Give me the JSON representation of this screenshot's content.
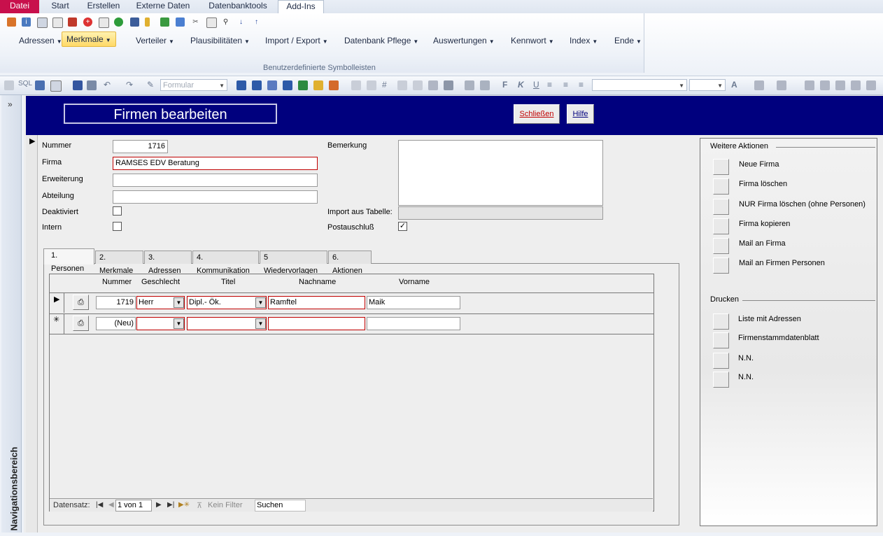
{
  "ribbon": {
    "tabs": [
      "Datei",
      "Start",
      "Erstellen",
      "Externe Daten",
      "Datenbanktools",
      "Add-Ins"
    ],
    "menu": [
      "Adressen",
      "Merkmale",
      "Verteiler",
      "Plausibilitäten",
      "Import / Export",
      "Datenbank Pflege",
      "Auswertungen",
      "Kennwort",
      "Index",
      "Ende"
    ],
    "group_label": "Benutzerdefinierte Symbolleisten"
  },
  "toolbar": {
    "sql_label": "SQL",
    "view_combo": "Formular",
    "bold": "F",
    "italic": "K",
    "underline": "U"
  },
  "nav_pane": {
    "chevron": "»",
    "label": "Navigationsbereich"
  },
  "form": {
    "title": "Firmen bearbeiten",
    "close_button": "Schließen",
    "help_button": "Hilfe",
    "labels": {
      "nummer": "Nummer",
      "firma": "Firma",
      "erweiterung": "Erweiterung",
      "abteilung": "Abteilung",
      "deaktiviert": "Deaktiviert",
      "intern": "Intern",
      "bemerkung": "Bemerkung",
      "import": "Import aus Tabelle:",
      "postausschluss": "Postauschluß"
    },
    "values": {
      "nummer": "1716",
      "firma": "RAMSES EDV Beratung",
      "erweiterung": "",
      "abteilung": "",
      "bemerkung": "",
      "import": "",
      "deaktiviert": false,
      "intern": false,
      "postausschluss": true
    },
    "check_mark": "✓"
  },
  "side_panel": {
    "actions_title": "Weitere Aktionen",
    "actions": [
      "Neue Firma",
      "Firma löschen",
      "NUR Firma löschen (ohne Personen)",
      "Firma kopieren",
      "Mail an Firma",
      "Mail an Firmen Personen"
    ],
    "print_title": "Drucken",
    "print": [
      "Liste mit Adressen",
      "Firmenstammdatenblatt",
      "N.N.",
      "N.N."
    ]
  },
  "tabs": [
    "1. Personen",
    "2. Merkmale",
    "3. Adressen",
    "4. Kommunikation",
    "5 Wiedervorlagen",
    "6. Aktionen"
  ],
  "persons": {
    "columns": [
      "Nummer",
      "Geschlecht",
      "Titel",
      "Nachname",
      "Vorname"
    ],
    "rows": [
      {
        "nummer": "1719",
        "geschlecht": "Herr",
        "titel": "Dipl.- Ök.",
        "nachname": "Ramftel",
        "vorname": "Maik"
      },
      {
        "nummer": "(Neu)",
        "geschlecht": "",
        "titel": "",
        "nachname": "",
        "vorname": ""
      }
    ],
    "current_marker": "▶",
    "new_marker": "✳"
  },
  "record_nav": {
    "label": "Datensatz:",
    "position": "1 von 1",
    "filter": "Kein Filter",
    "search_placeholder": "Suchen"
  }
}
